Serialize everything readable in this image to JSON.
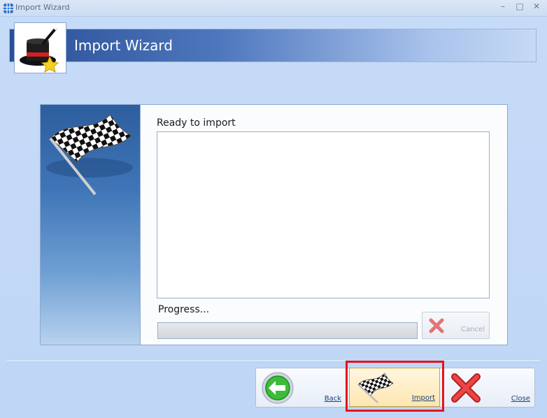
{
  "window": {
    "title": "Import Wizard",
    "controls": {
      "minimize": "–",
      "maximize": "□",
      "close": "✕"
    }
  },
  "header": {
    "title": "Import Wizard",
    "icon": "magic-hat-icon"
  },
  "main": {
    "status_label": "Ready to import",
    "log_text": "",
    "progress_label": "Progress...",
    "progress_value": 0,
    "cancel": {
      "label": "Cancel",
      "icon": "red-x-icon",
      "enabled": false
    }
  },
  "footer": {
    "back": {
      "label": "Back",
      "icon": "green-back-arrow-icon"
    },
    "import": {
      "label": "Import",
      "icon": "checkered-flag-icon",
      "highlighted": true
    },
    "close": {
      "label": "Close",
      "icon": "red-x-icon"
    }
  },
  "colors": {
    "accent": "#2a4f97",
    "highlight": "#e2151b",
    "background": "#c9dcf5"
  }
}
